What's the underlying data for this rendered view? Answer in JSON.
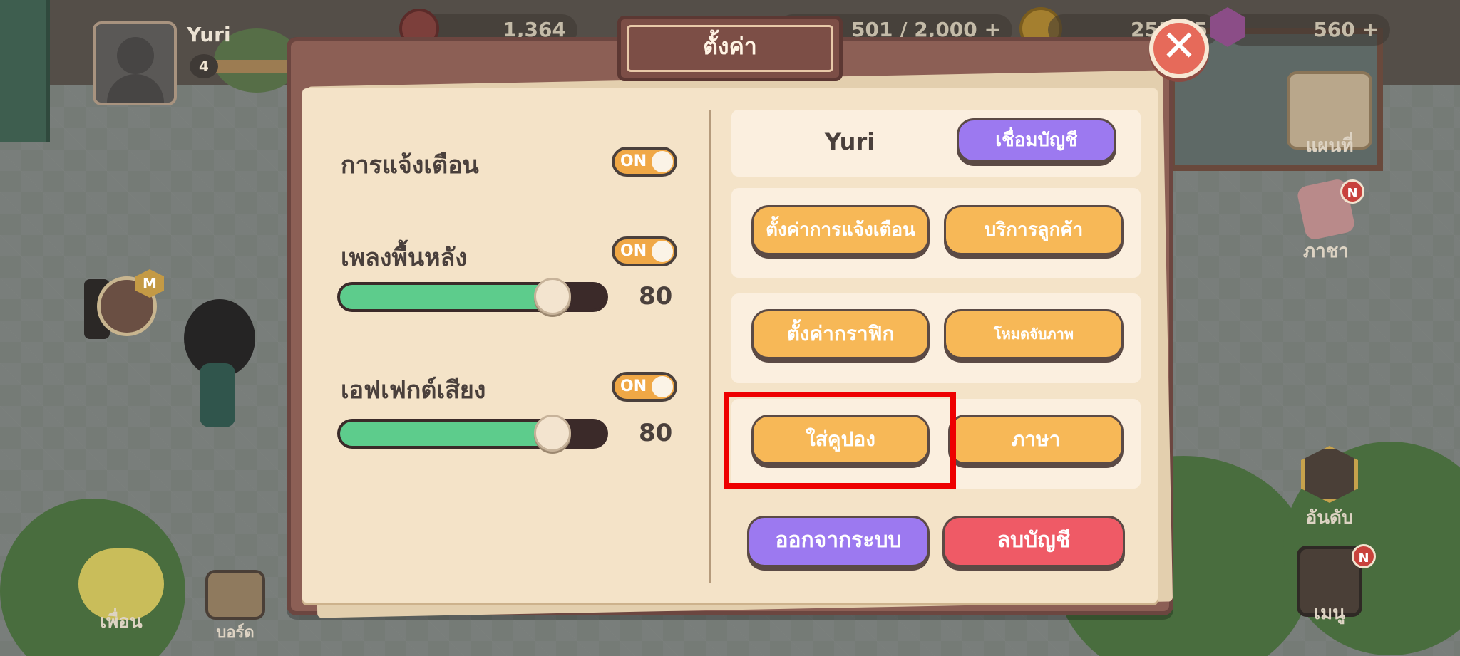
{
  "hud": {
    "player_name": "Yuri",
    "level": "4",
    "stat_1": "1,364",
    "energy": "501 / 2,000",
    "energy_plus": "+",
    "gold": "255,45",
    "gems": "560",
    "gems_plus": "+"
  },
  "side": {
    "map_label": "แผนที่",
    "language_label": "ภาชา",
    "ranking_label": "อันดับ",
    "menu_label": "เมนู",
    "friends_label": "เพื่อน",
    "board_label": "บอร์ด",
    "m_badge": "M",
    "n_badge": "N"
  },
  "modal": {
    "title": "ตั้งค่า",
    "close_symbol": "✕",
    "notifications_label": "การแจ้งเตือน",
    "notifications_toggle": "ON",
    "bgm_label": "เพลงพื้นหลัง",
    "bgm_toggle": "ON",
    "bgm_value": "80",
    "sfx_label": "เอฟเฟกต์เสียง",
    "sfx_toggle": "ON",
    "sfx_value": "80",
    "account_name": "Yuri",
    "link_account": "เชื่อมบัญชี",
    "notification_settings": "ตั้งค่าการแจ้งเตือน",
    "customer_service": "บริการลูกค้า",
    "graphics_settings": "ตั้งค่ากราฟิก",
    "capture_mode": "โหมดจับภาพ",
    "enter_coupon": "ใส่คูปอง",
    "language": "ภาษา",
    "logout": "ออกจากระบบ",
    "delete_account": "ลบบัญชี"
  },
  "levels": {
    "bgm_fraction": 0.8,
    "sfx_fraction": 0.8
  },
  "colors": {
    "toggle_on": "#f0a846",
    "slider_fill": "#5dcc8c",
    "button_orange": "#f7b857",
    "button_purple": "#9c79f0",
    "button_red": "#ef5a66",
    "highlight": "#ee0000"
  }
}
